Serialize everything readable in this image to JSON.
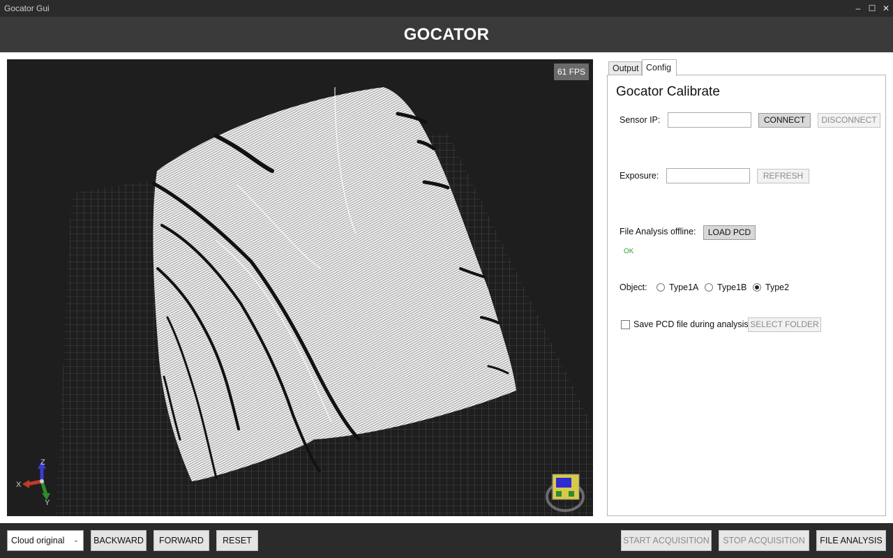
{
  "window": {
    "title": "Gocator Gui",
    "minimize_label": "–",
    "maximize_label": "☐",
    "close_label": "✕"
  },
  "header": {
    "brand": "GOCATOR"
  },
  "viewer": {
    "fps_label": "61 FPS",
    "axis_labels": {
      "x": "X",
      "y": "Y",
      "z": "Z"
    },
    "axis_colors": {
      "x": "#c0392b",
      "y": "#2e8b2e",
      "z": "#3b3bd1"
    },
    "background_color": "#1e1e1e",
    "grid_color": "#6e6e6e",
    "cloud_color": "#ffffff"
  },
  "tabs": [
    {
      "label": "Output",
      "active": false
    },
    {
      "label": "Config",
      "active": true
    }
  ],
  "config": {
    "title": "Gocator Calibrate",
    "sensor_ip_label": "Sensor IP:",
    "sensor_ip_value": "",
    "connect_label": "CONNECT",
    "disconnect_label": "DISCONNECT",
    "exposure_label": "Exposure:",
    "exposure_value": "",
    "refresh_label": "REFRESH",
    "file_analysis_label": "File Analysis offline:",
    "load_pcd_label": "LOAD PCD",
    "status_text": "OK",
    "status_color": "#3a9e3a",
    "object_label": "Object:",
    "object_options": [
      {
        "label": "Type1A",
        "checked": false
      },
      {
        "label": "Type1B",
        "checked": false
      },
      {
        "label": "Type2",
        "checked": true
      }
    ],
    "save_pcd_label": "Save PCD file during analysis",
    "save_pcd_checked": false,
    "select_folder_label": "SELECT FOLDER"
  },
  "bottom": {
    "cloud_select_value": "Cloud original",
    "backward_label": "BACKWARD",
    "forward_label": "FORWARD",
    "reset_label": "RESET",
    "start_acquisition_label": "START ACQUISITION",
    "stop_acquisition_label": "STOP ACQUISITION",
    "file_analysis_label": "FILE ANALYSIS"
  }
}
